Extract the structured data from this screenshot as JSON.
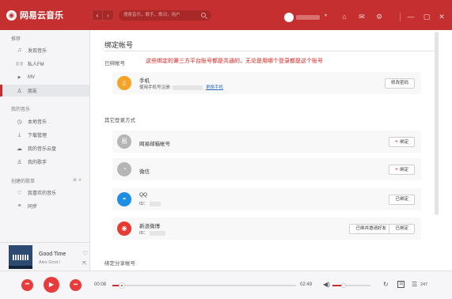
{
  "app": {
    "logo_glyph": "◉",
    "name": "网易云音乐",
    "accent": "#c62f2f"
  },
  "topbar": {
    "back_glyph": "‹",
    "forward_glyph": "›",
    "search_placeholder": "搜索音乐，歌手，歌词，用户",
    "dropdown_glyph": "▾",
    "icons": {
      "skin": "⌂",
      "mail": "✉",
      "settings": "⚙",
      "minimize": "—",
      "maximize": "▢",
      "close": "✕"
    }
  },
  "sidebar": {
    "recommend_title": "推荐",
    "recommend_items": [
      {
        "icon": "♫",
        "label": "发现音乐"
      },
      {
        "icon": "((·))",
        "label": "私人FM"
      },
      {
        "icon": "▶",
        "label": "MV"
      },
      {
        "icon": "♙",
        "label": "朋友"
      }
    ],
    "my_music_title": "我的音乐",
    "my_music_items": [
      {
        "icon": "◷",
        "label": "本地音乐"
      },
      {
        "icon": "⤓",
        "label": "下载管理"
      },
      {
        "icon": "☁",
        "label": "我的音乐云盘"
      },
      {
        "icon": "♙",
        "label": "我的歌手"
      }
    ],
    "created_title": "创建的歌单",
    "created_ctrls": "⊕ ∨",
    "created_items": [
      {
        "icon": "♡",
        "label": "我喜欢的音乐"
      },
      {
        "icon": "≡",
        "label": "同步"
      }
    ]
  },
  "now_playing": {
    "title": "Good Time",
    "artist": "Alex Goot /",
    "heart_glyph": "♡",
    "share_glyph": "⇱"
  },
  "main": {
    "page_title": "绑定帐号",
    "bound_section": "已绑帐号",
    "notice": "这些绑定的第三方平台账号都是共通的，无论是用哪个登录都是这个账号",
    "phone": {
      "icon": "▯",
      "label": "手机",
      "sub": "使用手机号注册:",
      "link": "更换手机",
      "button": "修改密码",
      "color": "#f3a327"
    },
    "other_section": "其它登录方式",
    "accounts": [
      {
        "key": "netease-mail",
        "icon": "易",
        "label": "网易邮箱帐号",
        "id_prefix": "",
        "button": "绑定",
        "add": true,
        "extra": "",
        "color": "#b5b5b5"
      },
      {
        "key": "wechat",
        "icon": "◔",
        "label": "微信",
        "id_prefix": "",
        "button": "绑定",
        "add": true,
        "extra": "",
        "color": "#b5b5b5"
      },
      {
        "key": "qq",
        "icon": "◓",
        "label": "QQ",
        "id_prefix": "ID：",
        "button": "已绑定",
        "add": false,
        "extra": "",
        "color": "#1d8ee3"
      },
      {
        "key": "weibo",
        "icon": "◉",
        "label": "新浪微博",
        "id_prefix": "ID：",
        "button": "已绑定",
        "add": false,
        "extra": "已绑并邀请好友",
        "color": "#e63a33"
      }
    ],
    "share_section": "绑定分享帐号"
  },
  "player": {
    "prev_glyph": "⏮",
    "play_glyph": "▶",
    "next_glyph": "⏭",
    "current_time": "00:08",
    "total_time": "02:49",
    "progress": 0.05,
    "volume_glyph": "◀)",
    "volume": 0.3,
    "mode_glyph": "↻",
    "lyric_glyph": "词",
    "playlist_glyph": "☰",
    "playlist_count": "247"
  }
}
